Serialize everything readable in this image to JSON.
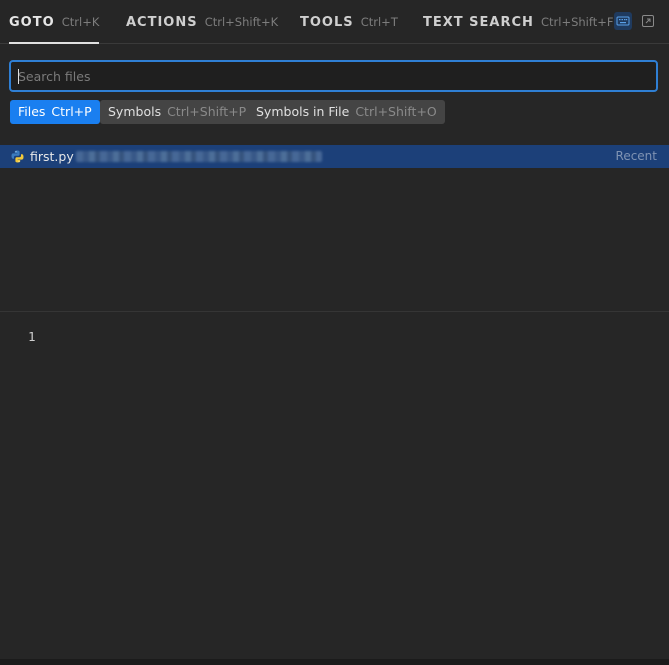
{
  "tabs": [
    {
      "name": "GOTO",
      "shortcut": "Ctrl+K",
      "active": true
    },
    {
      "name": "ACTIONS",
      "shortcut": "Ctrl+Shift+K",
      "active": false
    },
    {
      "name": "TOOLS",
      "shortcut": "Ctrl+T",
      "active": false
    },
    {
      "name": "TEXT SEARCH",
      "shortcut": "Ctrl+Shift+F",
      "active": false
    }
  ],
  "toolbar_icons": [
    "keyboard-icon",
    "popout-icon"
  ],
  "search": {
    "placeholder": "Search files",
    "value": ""
  },
  "filters": [
    {
      "label": "Files",
      "shortcut": "Ctrl+P",
      "active": true
    },
    {
      "label": "Symbols",
      "shortcut": "Ctrl+Shift+P",
      "active": false
    },
    {
      "label": "Symbols in File",
      "shortcut": "Ctrl+Shift+O",
      "active": false
    }
  ],
  "results": [
    {
      "icon": "python-icon",
      "name": "first.py",
      "badge": "Recent"
    }
  ],
  "editor": {
    "line_numbers": [
      "1"
    ]
  },
  "colors": {
    "background": "#262626",
    "accent": "#1a7ff0",
    "selected_row": "#1c4079",
    "input_border": "#2f7fd4"
  }
}
